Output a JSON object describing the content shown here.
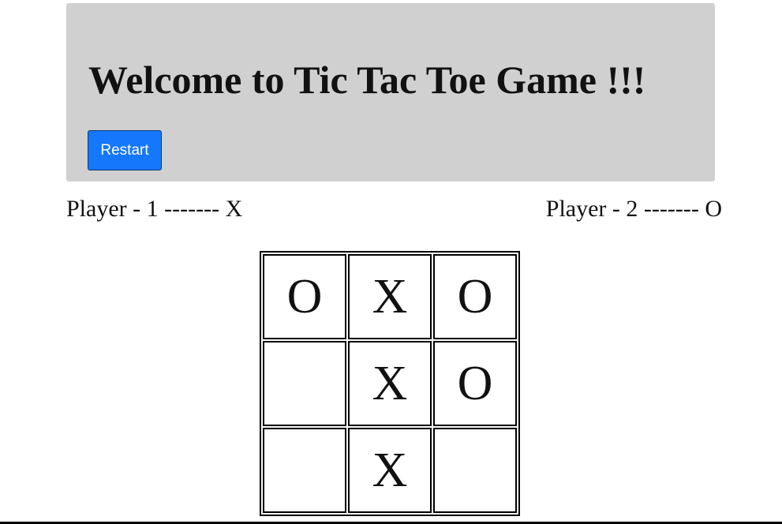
{
  "header": {
    "title": "Welcome to Tic Tac Toe Game !!!",
    "restart_label": "Restart",
    "background_color": "#d0d0d0",
    "button_color": "#1577fb"
  },
  "players": {
    "player1": "Player - 1 ------- X",
    "player2": "Player - 2 ------- O"
  },
  "board": {
    "cells": [
      [
        "O",
        "X",
        "O"
      ],
      [
        "",
        "X",
        "O"
      ],
      [
        "",
        "X",
        ""
      ]
    ]
  }
}
